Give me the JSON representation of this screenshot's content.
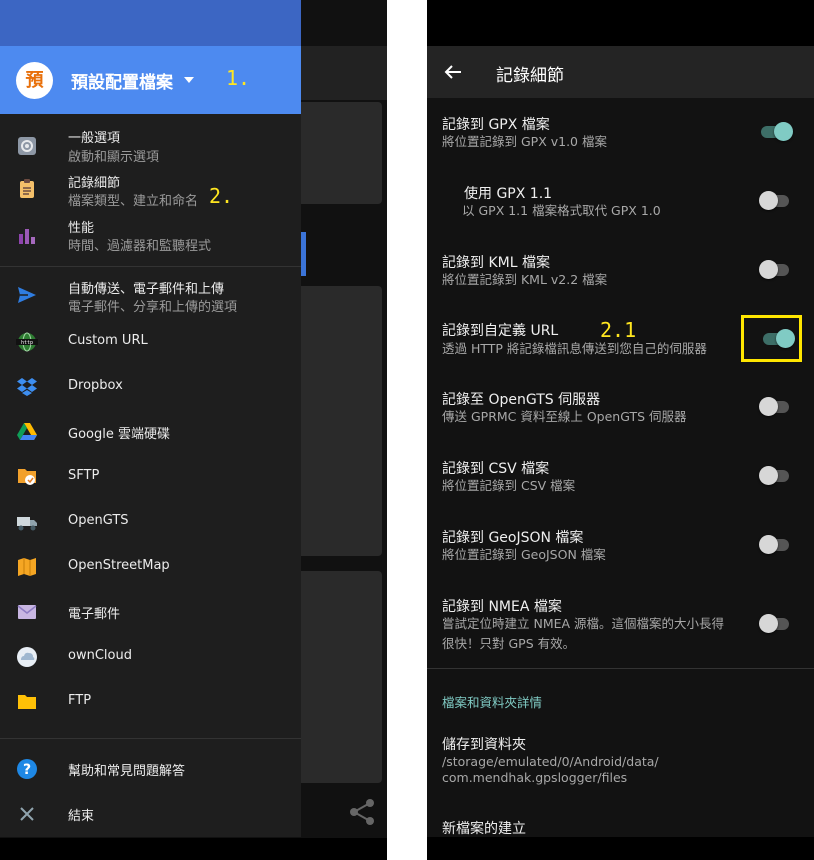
{
  "left_screen": {
    "profile": {
      "avatar_char": "預",
      "name": "預設配置檔案",
      "annotation": "1."
    },
    "nav_items": [
      {
        "title": "一般選項",
        "subtitle": "啟動和顯示選項",
        "icon": "gear-icon"
      },
      {
        "title": "記錄細節",
        "subtitle": "檔案類型、建立和命名",
        "icon": "clipboard-icon",
        "annotation": "2."
      },
      {
        "title": "性能",
        "subtitle": "時間、過濾器和監聽程式",
        "icon": "bar-chart-icon"
      },
      {
        "title": "自動傳送、電子郵件和上傳",
        "subtitle": "電子郵件、分享和上傳的選項",
        "icon": "send-icon"
      },
      {
        "title": "Custom URL",
        "icon": "http-icon"
      },
      {
        "title": "Dropbox",
        "icon": "dropbox-icon"
      },
      {
        "title": "Google 雲端硬碟",
        "icon": "google-drive-icon"
      },
      {
        "title": "SFTP",
        "icon": "sftp-icon"
      },
      {
        "title": "OpenGTS",
        "icon": "truck-icon"
      },
      {
        "title": "OpenStreetMap",
        "icon": "map-icon"
      },
      {
        "title": "電子郵件",
        "icon": "envelope-icon"
      },
      {
        "title": "ownCloud",
        "icon": "cloud-icon"
      },
      {
        "title": "FTP",
        "icon": "folder-icon"
      },
      {
        "title": "幫助和常見問題解答",
        "icon": "help-icon"
      },
      {
        "title": "結束",
        "icon": "close-icon"
      }
    ]
  },
  "right_screen": {
    "appbar": {
      "title": "記錄細節"
    },
    "prefs": [
      {
        "title": "記錄到 GPX 檔案",
        "subtitle": "將位置記錄到 GPX v1.0 檔案",
        "enabled": true
      },
      {
        "title": "使用 GPX 1.1",
        "subtitle": "以 GPX 1.1 檔案格式取代 GPX 1.0",
        "enabled": false
      },
      {
        "title": "記錄到 KML 檔案",
        "subtitle": "將位置記錄到 KML v2.2 檔案",
        "enabled": false
      },
      {
        "title": "記錄到自定義 URL",
        "subtitle": "透過 HTTP 將記錄檔訊息傳送到您自己的伺服器",
        "enabled": true,
        "annotation": "2.1"
      },
      {
        "title": "記錄至 OpenGTS 伺服器",
        "subtitle": "傳送 GPRMC 資料至線上 OpenGTS 伺服器",
        "enabled": false
      },
      {
        "title": "記錄到 CSV 檔案",
        "subtitle": "將位置記錄到 CSV 檔案",
        "enabled": false
      },
      {
        "title": "記錄到 GeoJSON 檔案",
        "subtitle": "將位置記錄到 GeoJSON 檔案",
        "enabled": false
      },
      {
        "title": "記錄到 NMEA 檔案",
        "subtitle_line1": "嘗試定位時建立 NMEA 源檔。這個檔案的大小長得",
        "subtitle_line2": "很快！只對 GPS 有效。",
        "enabled": false
      }
    ],
    "section_header": "檔案和資料夾詳情",
    "save_folder": {
      "title": "儲存到資料夾",
      "path_line1": "/storage/emulated/0/Android/data/",
      "path_line2": "com.mendhak.gpslogger/files"
    },
    "new_file": {
      "title": "新檔案的建立"
    }
  },
  "colors": {
    "drawer_header": "#4d8af0",
    "accent_teal": "#80cbc4",
    "highlight_yellow": "#ffe600"
  }
}
